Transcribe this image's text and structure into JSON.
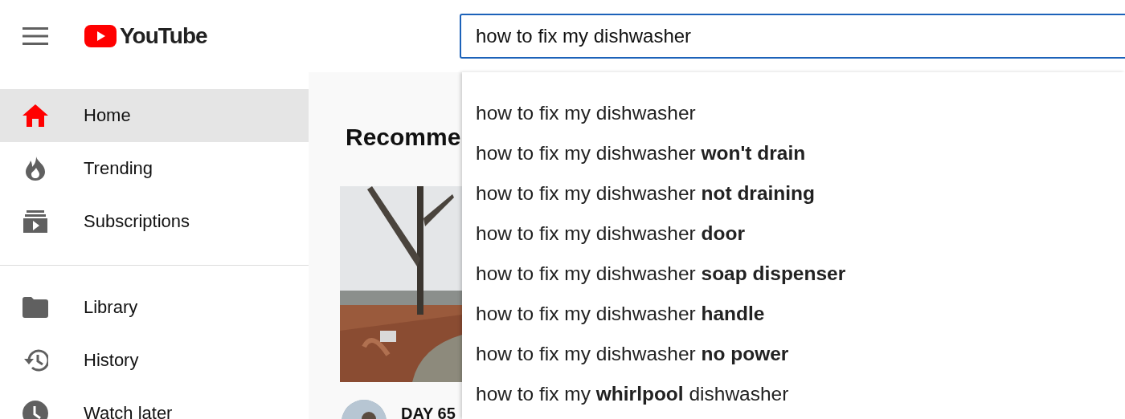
{
  "header": {
    "logo": "YouTube",
    "search": {
      "value": "how to fix my dishwasher"
    }
  },
  "sidebar": {
    "sections": [
      {
        "items": [
          {
            "label": "Home",
            "selected": true
          },
          {
            "label": "Trending",
            "selected": false
          },
          {
            "label": "Subscriptions",
            "selected": false
          }
        ]
      },
      {
        "items": [
          {
            "label": "Library",
            "selected": false
          },
          {
            "label": "History",
            "selected": false
          },
          {
            "label": "Watch later",
            "selected": false
          }
        ]
      }
    ]
  },
  "main": {
    "heading": "Recomme",
    "video": {
      "title": "DAY 65"
    }
  },
  "suggestions": [
    "how to fix my dishwasher",
    "how to fix my dishwasher **won't drain**",
    "how to fix my dishwasher **not draining**",
    "how to fix my dishwasher **door**",
    "how to fix my dishwasher **soap dispenser**",
    "how to fix my dishwasher **handle**",
    "how to fix my dishwasher **no power**",
    "how to fix my **whirlpool** dishwasher"
  ]
}
